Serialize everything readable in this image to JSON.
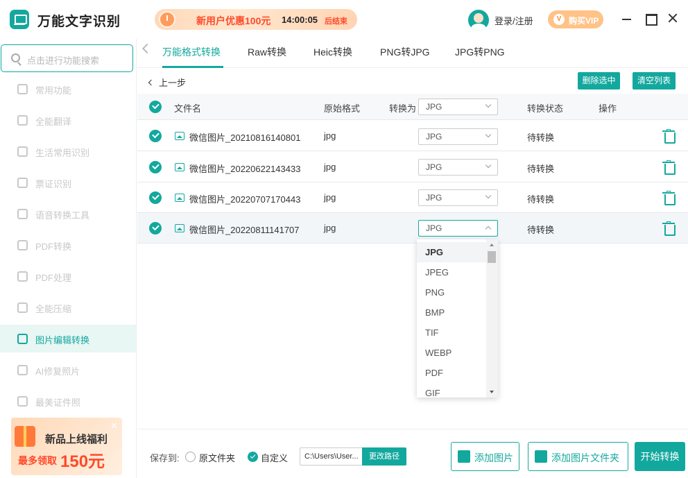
{
  "app": {
    "title": "万能文字识别"
  },
  "header": {
    "promo_text": "新用户优惠100元",
    "promo_time": "14:00:05",
    "promo_end": "后结束",
    "login": "登录/注册",
    "vip": "购买VIP",
    "vip_icon_letter": "V"
  },
  "sidebar": {
    "search_placeholder": "点击进行功能搜索",
    "items": [
      {
        "label": "常用功能",
        "icon": "star-icon"
      },
      {
        "label": "全能翻译",
        "icon": "translate-icon"
      },
      {
        "label": "生活常用识别",
        "icon": "scan-icon"
      },
      {
        "label": "票证识别",
        "icon": "ticket-icon"
      },
      {
        "label": "语音转换工具",
        "icon": "voice-icon"
      },
      {
        "label": "PDF转换",
        "icon": "pdf-icon"
      },
      {
        "label": "PDF处理",
        "icon": "pdf-edit-icon"
      },
      {
        "label": "全能压缩",
        "icon": "compress-icon"
      },
      {
        "label": "图片编辑转换",
        "icon": "image-edit-icon"
      },
      {
        "label": "AI修复照片",
        "icon": "ai-repair-icon"
      },
      {
        "label": "最美证件照",
        "icon": "id-photo-icon"
      }
    ],
    "active_index": 8,
    "ad": {
      "line1": "新品上线福利",
      "line2a": "最多领取",
      "line2b": "150元",
      "close": "✕"
    }
  },
  "tabs": [
    {
      "label": "万能格式转换"
    },
    {
      "label": "Raw转换"
    },
    {
      "label": "Heic转换"
    },
    {
      "label": "PNG转JPG"
    },
    {
      "label": "JPG转PNG"
    }
  ],
  "toolbar": {
    "back": "上一步",
    "delete_selected": "删除选中",
    "clear_list": "清空列表"
  },
  "table": {
    "headers": {
      "filename": "文件名",
      "original_format": "原始格式",
      "convert_to": "转换为",
      "convert_to_value": "JPG",
      "status": "转换状态",
      "actions": "操作"
    },
    "rows": [
      {
        "name": "微信图片_20210816140801",
        "format": "jpg",
        "target": "JPG",
        "status": "待转换"
      },
      {
        "name": "微信图片_20220622143433",
        "format": "jpg",
        "target": "JPG",
        "status": "待转换"
      },
      {
        "name": "微信图片_20220707170443",
        "format": "jpg",
        "target": "JPG",
        "status": "待转换"
      },
      {
        "name": "微信图片_20220811141707",
        "format": "jpg",
        "target": "JPG",
        "status": "待转换"
      }
    ]
  },
  "dropdown": {
    "options": [
      "JPG",
      "JPEG",
      "PNG",
      "BMP",
      "TIF",
      "WEBP",
      "PDF",
      "GIF"
    ],
    "selected": "JPG"
  },
  "footer": {
    "save_to": "保存到:",
    "option_original": "原文件夹",
    "option_custom": "自定义",
    "path_value": "C:\\Users\\User...",
    "change_path": "更改路径",
    "add_image": "添加图片",
    "add_folder": "添加图片文件夹",
    "start": "开始转换"
  }
}
